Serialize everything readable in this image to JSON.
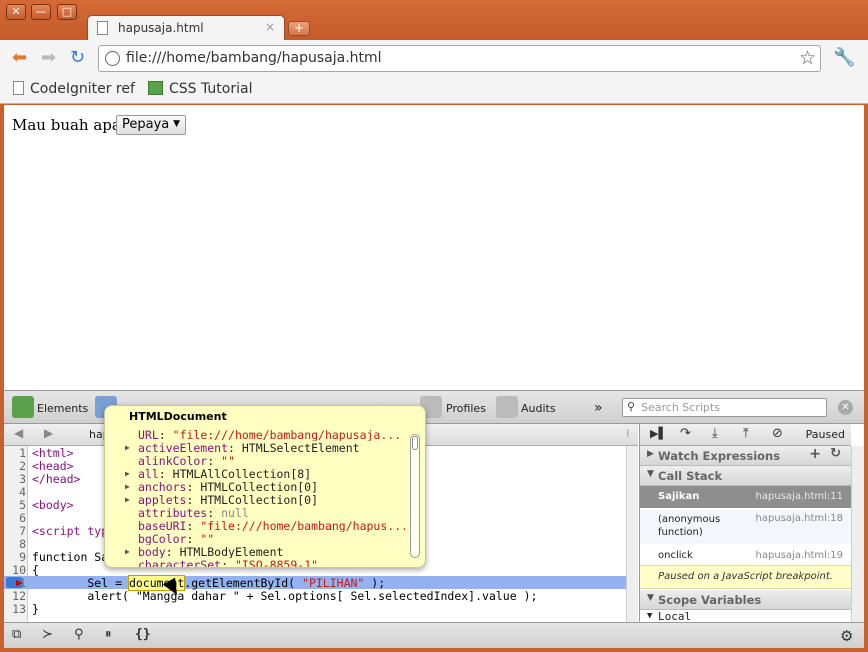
{
  "window": {
    "controls": [
      "✕",
      "—",
      "□"
    ]
  },
  "tab": {
    "title": "hapusaja.html",
    "close": "×",
    "newtab": "+"
  },
  "toolbar": {
    "back": "⬅",
    "forward": "➡",
    "reload": "↻",
    "url": "file:///home/bambang/hapusaja.html",
    "star": "☆",
    "wrench": "🔧"
  },
  "bookmarks": [
    {
      "label": "CodeIgniter ref"
    },
    {
      "label": "CSS Tutorial"
    }
  ],
  "page": {
    "label": "Mau buah apa?",
    "select_value": "Pepaya"
  },
  "devtools": {
    "tabs": [
      "Elements",
      "Profiles",
      "Audits"
    ],
    "more": "»",
    "search_placeholder": "Search Scripts",
    "file_tab": "hap",
    "code_lines": [
      {
        "n": "1",
        "text": "<html>"
      },
      {
        "n": "2",
        "text": "<head>"
      },
      {
        "n": "3",
        "text": "</head>"
      },
      {
        "n": "4",
        "text": ""
      },
      {
        "n": "5",
        "text": "<body>"
      },
      {
        "n": "6",
        "text": ""
      },
      {
        "n": "7",
        "text": "<script typ"
      },
      {
        "n": "8",
        "text": ""
      },
      {
        "n": "9",
        "text": "function Sa"
      },
      {
        "n": "10",
        "text": "{"
      },
      {
        "n": "11",
        "text": "        Sel = document.getElementById( \"PILIHAN\" );"
      },
      {
        "n": "12",
        "text": "        alert( \"Mangga dahar \" + Sel.options[ Sel.selectedIndex].value );"
      },
      {
        "n": "13",
        "text": "}"
      }
    ],
    "debug": {
      "status": "Paused",
      "watch_title": "Watch Expressions",
      "callstack_title": "Call Stack",
      "frames": [
        {
          "name": "Sajikan",
          "loc": "hapusaja.html:11"
        },
        {
          "name": "(anonymous function)",
          "loc": "hapusaja.html:18"
        },
        {
          "name": "onclick",
          "loc": "hapusaja.html:19"
        }
      ],
      "paused_msg": "Paused on a JavaScript breakpoint.",
      "scope_title": "Scope Variables",
      "local": "Local"
    },
    "popover": {
      "title": "HTMLDocument",
      "rows": [
        {
          "key": "URL",
          "val": "\"file:///home/bambang/hapusaja...",
          "kind": "str",
          "exp": false
        },
        {
          "key": "activeElement",
          "val": "HTMLSelectElement",
          "kind": "obj",
          "exp": true
        },
        {
          "key": "alinkColor",
          "val": "\"\"",
          "kind": "str",
          "exp": false
        },
        {
          "key": "all",
          "val": "HTMLAllCollection[8]",
          "kind": "obj",
          "exp": true
        },
        {
          "key": "anchors",
          "val": "HTMLCollection[0]",
          "kind": "obj",
          "exp": true
        },
        {
          "key": "applets",
          "val": "HTMLCollection[0]",
          "kind": "obj",
          "exp": true
        },
        {
          "key": "attributes",
          "val": "null",
          "kind": "null",
          "exp": false
        },
        {
          "key": "baseURI",
          "val": "\"file:///home/bambang/hapus...",
          "kind": "str",
          "exp": false
        },
        {
          "key": "bgColor",
          "val": "\"\"",
          "kind": "str",
          "exp": false
        },
        {
          "key": "body",
          "val": "HTMLBodyElement",
          "kind": "obj",
          "exp": true
        },
        {
          "key": "characterSet",
          "val": "\"ISO-8859-1\"",
          "kind": "str",
          "exp": false
        }
      ]
    }
  }
}
